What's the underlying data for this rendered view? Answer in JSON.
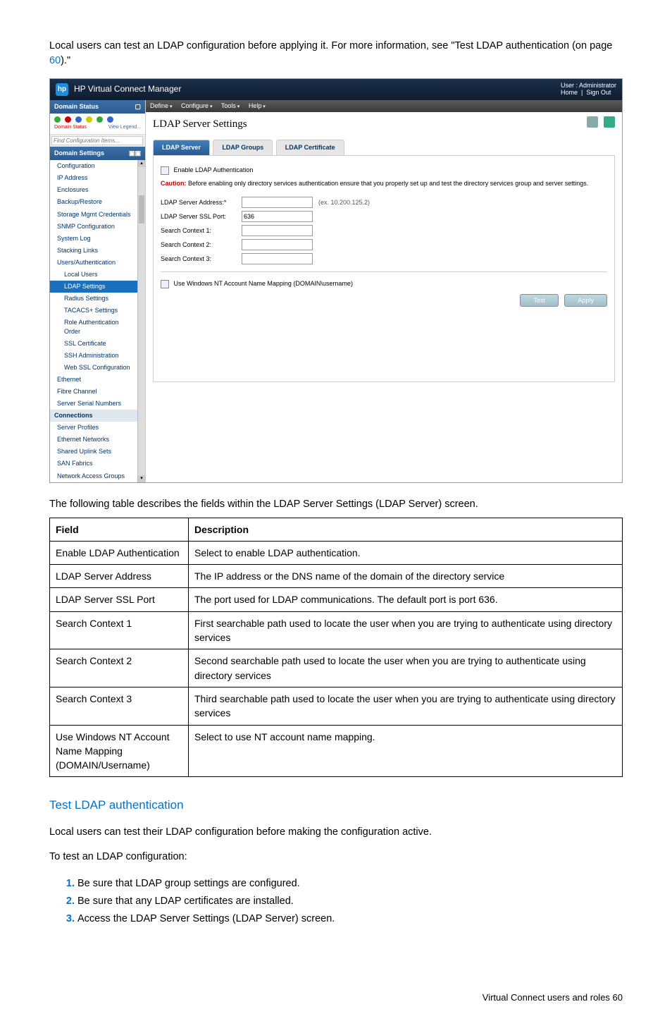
{
  "intro": {
    "text_a": "Local users can test an LDAP configuration before applying it. For more information, see \"Test LDAP authentication (on page ",
    "link": "60",
    "text_b": ").\""
  },
  "vc": {
    "product": "HP Virtual Connect Manager",
    "user_line": "User : Administrator",
    "home": "Home",
    "signout": "Sign Out",
    "menu": {
      "define": "Define",
      "configure": "Configure",
      "tools": "Tools",
      "help": "Help"
    },
    "domain_status_hd": "Domain Status",
    "status_domain": "Domain Status",
    "view_legend": "View Legend...",
    "find_placeholder": "Find Configuration Items...",
    "domain_settings_hd": "Domain Settings",
    "nav": {
      "configuration": "Configuration",
      "ip_address": "IP Address",
      "enclosures": "Enclosures",
      "backup_restore": "Backup/Restore",
      "storage_mgmt": "Storage Mgmt Credentials",
      "snmp": "SNMP Configuration",
      "system_log": "System Log",
      "stacking_links": "Stacking Links",
      "users_auth": "Users/Authentication",
      "local_users": "Local Users",
      "ldap_settings": "LDAP Settings",
      "radius": "Radius Settings",
      "tacacs": "TACACS+ Settings",
      "role_order": "Role Authentication Order",
      "ssl_cert": "SSL Certificate",
      "ssh_admin": "SSH Administration",
      "web_ssl": "Web SSL Configuration",
      "ethernet": "Ethernet",
      "fibre_channel": "Fibre Channel",
      "server_serial": "Server Serial Numbers",
      "connections_hd": "Connections",
      "server_profiles": "Server Profiles",
      "eth_networks": "Ethernet Networks",
      "shared_uplink": "Shared Uplink Sets",
      "san_fabrics": "SAN Fabrics",
      "net_access": "Network Access Groups"
    },
    "page_title": "LDAP Server Settings",
    "tabs": {
      "server": "LDAP Server",
      "groups": "LDAP Groups",
      "cert": "LDAP Certificate"
    },
    "enable_label": "Enable LDAP Authentication",
    "caution_b": "Caution:",
    "caution_t": " Before enabling only directory services authentication ensure that you properly set up and test the directory services group and server settings.",
    "labels": {
      "addr": "LDAP Server Address:*",
      "addr_hint": "(ex. 10.200.125.2)",
      "port": "LDAP Server SSL Port:",
      "sc1": "Search Context 1:",
      "sc2": "Search Context 2:",
      "sc3": "Search Context 3:",
      "nt": "Use Windows NT Account Name Mapping (DOMAIN\\username)"
    },
    "port_value": "636",
    "btn_test": "Test",
    "btn_apply": "Apply"
  },
  "between_para": "The following table describes the fields within the LDAP Server Settings (LDAP Server) screen.",
  "table": {
    "h_field": "Field",
    "h_desc": "Description",
    "rows": [
      {
        "f": "Enable LDAP Authentication",
        "d": "Select to enable LDAP authentication."
      },
      {
        "f": "LDAP Server Address",
        "d": "The IP address or the DNS name of the domain of the directory service"
      },
      {
        "f": "LDAP Server SSL Port",
        "d": "The port used for LDAP communications. The default port is port 636."
      },
      {
        "f": "Search Context 1",
        "d": "First searchable path used to locate the user when you are trying to authenticate using directory services"
      },
      {
        "f": "Search Context 2",
        "d": "Second searchable path used to locate the user when you are trying to authenticate using directory services"
      },
      {
        "f": "Search Context 3",
        "d": "Third searchable path used to locate the user when you are trying to authenticate using directory services"
      },
      {
        "f": "Use Windows NT Account Name Mapping (DOMAIN/Username)",
        "d": "Select to use NT account name mapping."
      }
    ]
  },
  "section_title": "Test LDAP authentication",
  "section_p1": "Local users can test their LDAP configuration before making the configuration active.",
  "section_p2": "To test an LDAP configuration:",
  "steps": [
    "Be sure that LDAP group settings are configured.",
    "Be sure that any LDAP certificates are installed.",
    "Access the LDAP Server Settings (LDAP Server) screen."
  ],
  "footer": "Virtual Connect users and roles   60"
}
